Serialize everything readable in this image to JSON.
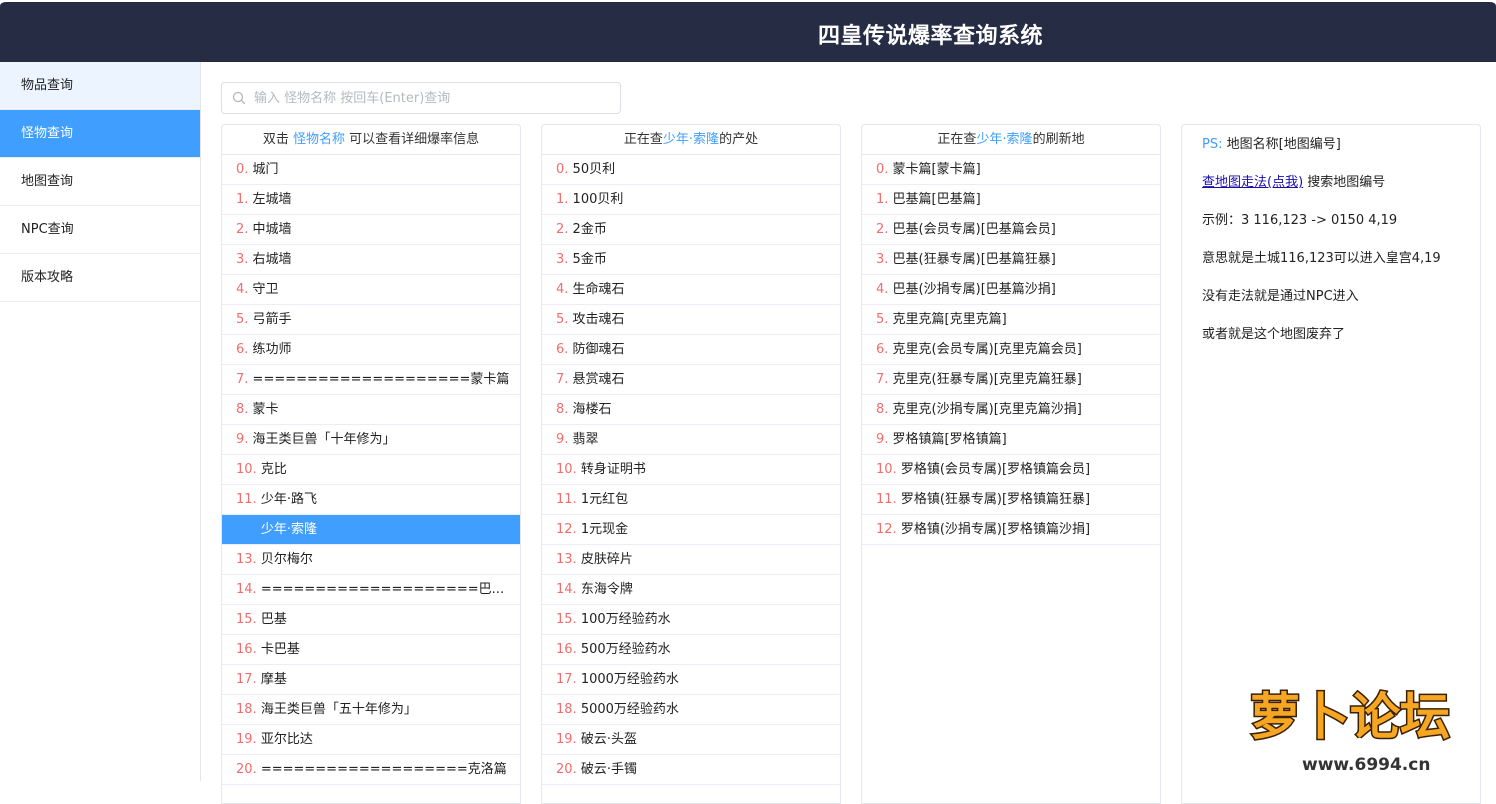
{
  "header": {
    "title": "四皇传说爆率查询系统"
  },
  "sidebar": {
    "items": [
      {
        "label": "物品查询"
      },
      {
        "label": "怪物查询"
      },
      {
        "label": "地图查询"
      },
      {
        "label": "NPC查询"
      },
      {
        "label": "版本攻略"
      }
    ],
    "active_index": 1
  },
  "search": {
    "placeholder": "输入 怪物名称 按回车(Enter)查询",
    "value": ""
  },
  "monsters": {
    "head": {
      "prefix": "双击 ",
      "highlight": "怪物名称",
      "suffix": " 可以查看详细爆率信息"
    },
    "selected_index": 12,
    "rows": [
      {
        "idx": "0.",
        "text": "城门"
      },
      {
        "idx": "1.",
        "text": "左城墙"
      },
      {
        "idx": "2.",
        "text": "中城墙"
      },
      {
        "idx": "3.",
        "text": "右城墙"
      },
      {
        "idx": "4.",
        "text": "守卫"
      },
      {
        "idx": "5.",
        "text": "弓箭手"
      },
      {
        "idx": "6.",
        "text": "练功师"
      },
      {
        "idx": "7.",
        "text": "====================蒙卡篇"
      },
      {
        "idx": "8.",
        "text": "蒙卡"
      },
      {
        "idx": "9.",
        "text": "海王类巨兽「十年修为」"
      },
      {
        "idx": "10.",
        "text": "克比"
      },
      {
        "idx": "11.",
        "text": "少年·路飞"
      },
      {
        "idx": "12.",
        "text": "少年·索隆"
      },
      {
        "idx": "13.",
        "text": "贝尔梅尔"
      },
      {
        "idx": "14.",
        "text": "====================巴..."
      },
      {
        "idx": "15.",
        "text": "巴基"
      },
      {
        "idx": "16.",
        "text": "卡巴基"
      },
      {
        "idx": "17.",
        "text": "摩基"
      },
      {
        "idx": "18.",
        "text": "海王类巨兽「五十年修为」"
      },
      {
        "idx": "19.",
        "text": "亚尔比达"
      },
      {
        "idx": "20.",
        "text": "===================克洛篇"
      }
    ]
  },
  "drops": {
    "head": {
      "prefix": "正在查",
      "highlight": "少年·索隆",
      "suffix": "的产处"
    },
    "rows": [
      {
        "idx": "0.",
        "text": "50贝利"
      },
      {
        "idx": "1.",
        "text": "100贝利"
      },
      {
        "idx": "2.",
        "text": "2金币"
      },
      {
        "idx": "3.",
        "text": "5金币"
      },
      {
        "idx": "4.",
        "text": "生命魂石"
      },
      {
        "idx": "5.",
        "text": "攻击魂石"
      },
      {
        "idx": "6.",
        "text": "防御魂石"
      },
      {
        "idx": "7.",
        "text": "悬赏魂石"
      },
      {
        "idx": "8.",
        "text": "海楼石"
      },
      {
        "idx": "9.",
        "text": "翡翠"
      },
      {
        "idx": "10.",
        "text": "转身证明书"
      },
      {
        "idx": "11.",
        "text": "1元红包"
      },
      {
        "idx": "12.",
        "text": "1元现金"
      },
      {
        "idx": "13.",
        "text": "皮肤碎片"
      },
      {
        "idx": "14.",
        "text": "东海令牌"
      },
      {
        "idx": "15.",
        "text": "100万经验药水"
      },
      {
        "idx": "16.",
        "text": "500万经验药水"
      },
      {
        "idx": "17.",
        "text": "1000万经验药水"
      },
      {
        "idx": "18.",
        "text": "5000万经验药水"
      },
      {
        "idx": "19.",
        "text": "破云·头盔"
      },
      {
        "idx": "20.",
        "text": "破云·手镯"
      }
    ]
  },
  "spawns": {
    "head": {
      "prefix": "正在查",
      "highlight": "少年·索隆",
      "suffix": "的刷新地"
    },
    "rows": [
      {
        "idx": "0.",
        "text": "蒙卡篇[蒙卡篇]"
      },
      {
        "idx": "1.",
        "text": "巴基篇[巴基篇]"
      },
      {
        "idx": "2.",
        "text": "巴基(会员专属)[巴基篇会员]"
      },
      {
        "idx": "3.",
        "text": "巴基(狂暴专属)[巴基篇狂暴]"
      },
      {
        "idx": "4.",
        "text": "巴基(沙捐专属)[巴基篇沙捐]"
      },
      {
        "idx": "5.",
        "text": "克里克篇[克里克篇]"
      },
      {
        "idx": "6.",
        "text": "克里克(会员专属)[克里克篇会员]"
      },
      {
        "idx": "7.",
        "text": "克里克(狂暴专属)[克里克篇狂暴]"
      },
      {
        "idx": "8.",
        "text": "克里克(沙捐专属)[克里克篇沙捐]"
      },
      {
        "idx": "9.",
        "text": "罗格镇篇[罗格镇篇]"
      },
      {
        "idx": "10.",
        "text": "罗格镇(会员专属)[罗格镇篇会员]"
      },
      {
        "idx": "11.",
        "text": "罗格镇(狂暴专属)[罗格镇篇狂暴]"
      },
      {
        "idx": "12.",
        "text": "罗格镇(沙捐专属)[罗格镇篇沙捐]"
      }
    ]
  },
  "info": {
    "ps_label": "PS:",
    "ps_text": "地图名称[地图编号]",
    "link_text": "查地图走法(点我)",
    "link_suffix": " 搜索地图编号",
    "example": "示例：3 116,123 -> 0150 4,19",
    "meaning": "意思就是土城116,123可以进入皇宫4,19",
    "no_route": "没有走法就是通过NPC进入",
    "abandoned": "或者就是这个地图废弃了"
  },
  "watermark": {
    "text": "萝卜论坛",
    "url_text": "www.6994.cn"
  }
}
